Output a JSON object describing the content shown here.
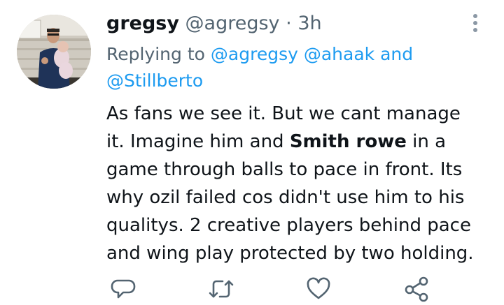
{
  "tweet": {
    "display_name": "gregsy",
    "handle": "@agregsy",
    "separator": "·",
    "time": "3h",
    "replying_prefix": "Replying to",
    "mention_1": "@agregsy",
    "mention_2": "@ahaak",
    "conjunction": "and",
    "mention_3": "@Stillberto",
    "text_lines": {
      "l1": "As fans we see it. But we cant manage",
      "l2_a": "it. Imagine him and ",
      "l2_bold": "Smith rowe",
      "l2_b": " in a",
      "l3": "game through balls to pace in front. Its",
      "l4": "why ozil failed cos didn't use him to his",
      "l5": "qualitys. 2 creative players behind pace",
      "l6": "and wing play protected by two holding."
    }
  },
  "icons": {
    "avatar": "profile-photo",
    "more": "more-vertical-icon",
    "reply": "reply-icon",
    "retweet": "retweet-icon",
    "like": "heart-icon",
    "share": "share-icon"
  },
  "colors": {
    "text": "#0f1419",
    "secondary": "#536471",
    "link": "#1d9bf0",
    "icon": "#536471"
  }
}
